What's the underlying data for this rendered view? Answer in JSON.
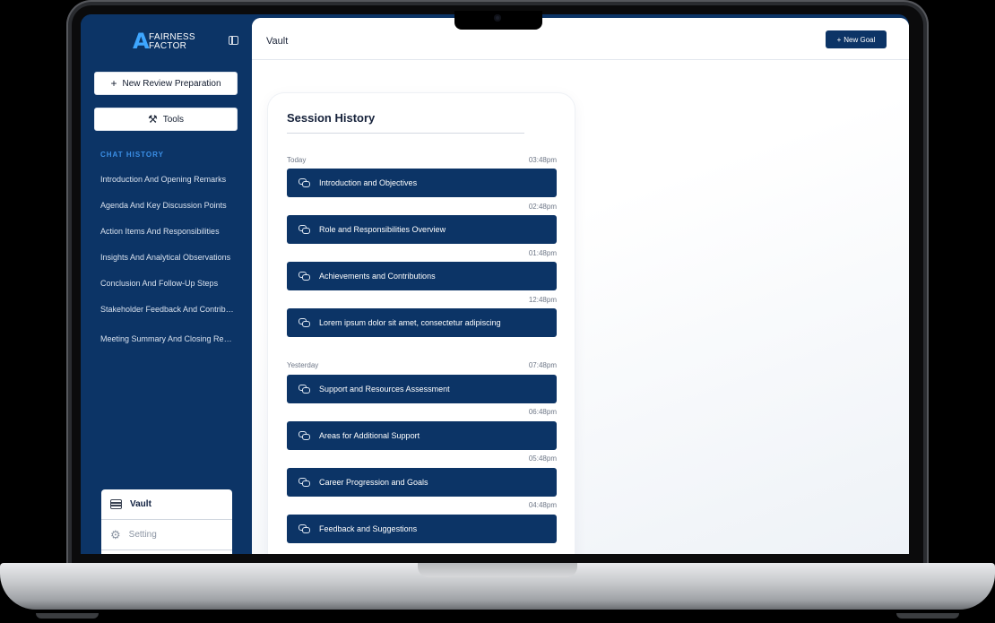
{
  "brand": {
    "logo_letter": "A",
    "logo_line1": "FAIRNESS",
    "logo_line2": "FACTOR"
  },
  "sidebar": {
    "new_review_label": "New Review Preparation",
    "tools_label": "Tools",
    "chat_history_heading": "CHAT HISTORY",
    "chat_items": [
      "Introduction And Opening Remarks",
      "Agenda And Key Discussion Points",
      "Action Items And Responsibilities",
      "Insights And Analytical Observations",
      "Conclusion And Follow-Up Steps",
      "Stakeholder Feedback And Contributions",
      "Meeting Summary And Closing Remarks"
    ],
    "nav": {
      "vault": "Vault",
      "setting": "Setting"
    }
  },
  "header": {
    "title": "Vault",
    "new_goal_label": "New Goal"
  },
  "session_history": {
    "title": "Session History",
    "groups": [
      {
        "label": "Today",
        "sessions": [
          {
            "time": "03:48pm",
            "title": "Introduction and Objectives"
          },
          {
            "time": "02:48pm",
            "title": "Role and Responsibilities Overview"
          },
          {
            "time": "01:48pm",
            "title": "Achievements and Contributions"
          },
          {
            "time": "12:48pm",
            "title": "Lorem ipsum dolor sit amet, consectetur adipiscing"
          }
        ]
      },
      {
        "label": "Yesterday",
        "sessions": [
          {
            "time": "07:48pm",
            "title": "Support and Resources Assessment"
          },
          {
            "time": "06:48pm",
            "title": "Areas for Additional Support"
          },
          {
            "time": "05:48pm",
            "title": "Career Progression and Goals"
          },
          {
            "time": "04:48pm",
            "title": "Feedback and Suggestions"
          }
        ]
      }
    ]
  },
  "colors": {
    "primary": "#0c3466",
    "accent": "#3ea6ff",
    "heading_accent": "#3b8fe6"
  }
}
